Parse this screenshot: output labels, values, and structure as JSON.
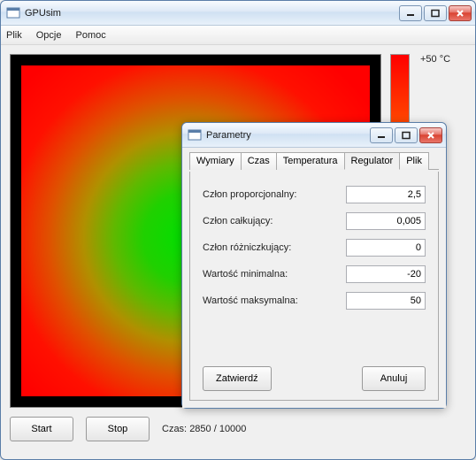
{
  "main": {
    "title": "GPUsim",
    "menu": {
      "file": "Plik",
      "options": "Opcje",
      "help": "Pomoc"
    },
    "scale_label": "+50 °C",
    "buttons": {
      "start": "Start",
      "stop": "Stop"
    },
    "status_prefix": "Czas: ",
    "status_value": "2850 / 10000"
  },
  "dialog": {
    "title": "Parametry",
    "tabs": {
      "dimensions": "Wymiary",
      "time": "Czas",
      "temperature": "Temperatura",
      "regulator": "Regulator",
      "file": "Plik"
    },
    "active_tab": "regulator",
    "fields": {
      "kp": {
        "label": "Człon proporcjonalny:",
        "value": "2,5"
      },
      "ki": {
        "label": "Człon całkujący:",
        "value": "0,005"
      },
      "kd": {
        "label": "Człon różniczkujący:",
        "value": "0"
      },
      "min": {
        "label": "Wartość minimalna:",
        "value": "-20"
      },
      "max": {
        "label": "Wartość maksymalna:",
        "value": "50"
      }
    },
    "buttons": {
      "ok": "Zatwierdź",
      "cancel": "Anuluj"
    }
  },
  "colors": {
    "accent": "#3b78b4",
    "close": "#d9402f"
  }
}
